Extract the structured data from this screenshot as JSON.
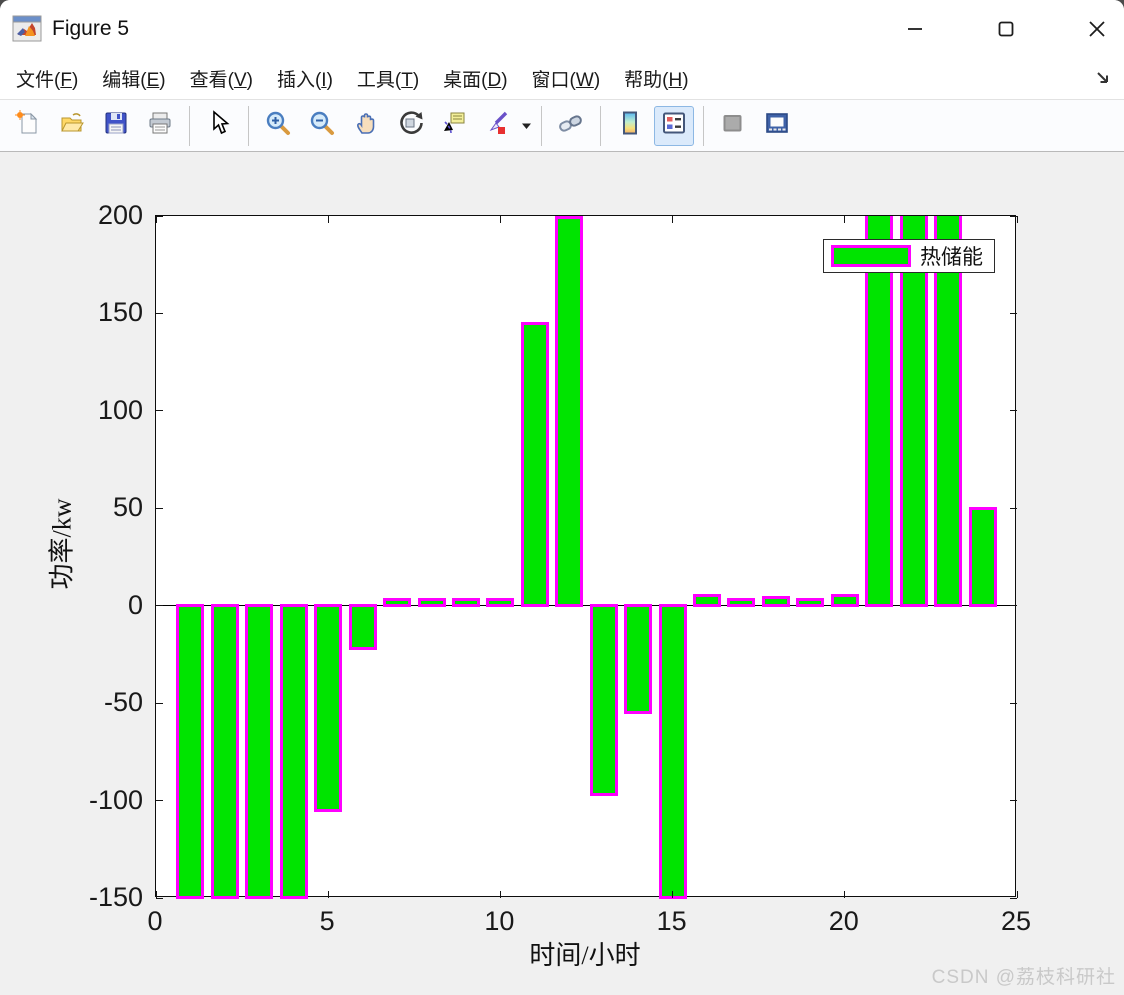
{
  "window": {
    "title": "Figure 5",
    "controls": {
      "minimize": "minimize-icon",
      "maximize": "maximize-icon",
      "close": "close-icon"
    }
  },
  "menu": {
    "items": [
      {
        "label": "文件",
        "mnemonic": "F"
      },
      {
        "label": "编辑",
        "mnemonic": "E"
      },
      {
        "label": "查看",
        "mnemonic": "V"
      },
      {
        "label": "插入",
        "mnemonic": "I"
      },
      {
        "label": "工具",
        "mnemonic": "T"
      },
      {
        "label": "桌面",
        "mnemonic": "D"
      },
      {
        "label": "窗口",
        "mnemonic": "W"
      },
      {
        "label": "帮助",
        "mnemonic": "H"
      }
    ],
    "dock_arrow_icon": "dock-arrow-icon"
  },
  "toolbar": {
    "active_bg": "#dbeafb",
    "buttons": [
      {
        "name": "new-figure-button",
        "icon": "new-document-icon"
      },
      {
        "name": "open-file-button",
        "icon": "open-folder-icon"
      },
      {
        "name": "save-figure-button",
        "icon": "save-icon"
      },
      {
        "name": "print-figure-button",
        "icon": "print-icon"
      },
      {
        "name": "separator"
      },
      {
        "name": "edit-plot-button",
        "icon": "cursor-icon"
      },
      {
        "name": "separator"
      },
      {
        "name": "zoom-in-button",
        "icon": "zoom-in-icon"
      },
      {
        "name": "zoom-out-button",
        "icon": "zoom-out-icon"
      },
      {
        "name": "pan-button",
        "icon": "hand-icon"
      },
      {
        "name": "rotate-3d-button",
        "icon": "rotate-3d-icon"
      },
      {
        "name": "data-cursor-button",
        "icon": "data-cursor-icon"
      },
      {
        "name": "brush-data-button",
        "icon": "brush-icon",
        "dropdown": true
      },
      {
        "name": "separator"
      },
      {
        "name": "link-plot-button",
        "icon": "link-icon"
      },
      {
        "name": "separator"
      },
      {
        "name": "insert-colorbar-button",
        "icon": "colorbar-icon"
      },
      {
        "name": "insert-legend-button",
        "icon": "legend-icon",
        "active": true
      },
      {
        "name": "separator"
      },
      {
        "name": "hide-plot-tools-button",
        "icon": "plot-tools-icon"
      },
      {
        "name": "dock-figure-button",
        "icon": "dock-window-icon"
      }
    ]
  },
  "chart_data": {
    "type": "bar",
    "series": [
      {
        "name": "热储能",
        "x": [
          1,
          2,
          3,
          4,
          5,
          6,
          7,
          8,
          9,
          10,
          11,
          12,
          13,
          14,
          15,
          16,
          17,
          18,
          19,
          20,
          21,
          22,
          23,
          24
        ],
        "values": [
          -150,
          -150,
          -150,
          -150,
          -105,
          -22,
          3,
          3,
          3,
          3,
          145,
          200,
          -97,
          -55,
          -150,
          5,
          3,
          4,
          3,
          5,
          200,
          200,
          200,
          50
        ]
      }
    ],
    "title": "",
    "xlabel": "时间/小时",
    "ylabel": "功率/kw",
    "xlim": [
      0,
      25
    ],
    "ylim": [
      -150,
      200
    ],
    "xticks": [
      0,
      5,
      10,
      15,
      20,
      25
    ],
    "yticks": [
      200,
      150,
      100,
      50,
      0,
      -50,
      -100,
      -150
    ],
    "bar_width_fraction": 0.8,
    "face_color": "#00e400",
    "edge_color": "#ff00ff",
    "clipped_top_x": [
      21,
      22,
      23
    ],
    "grid": false,
    "legend": {
      "entries": [
        "热储能"
      ],
      "position": "northeast"
    }
  },
  "watermark": "CSDN @荔枝科研社"
}
